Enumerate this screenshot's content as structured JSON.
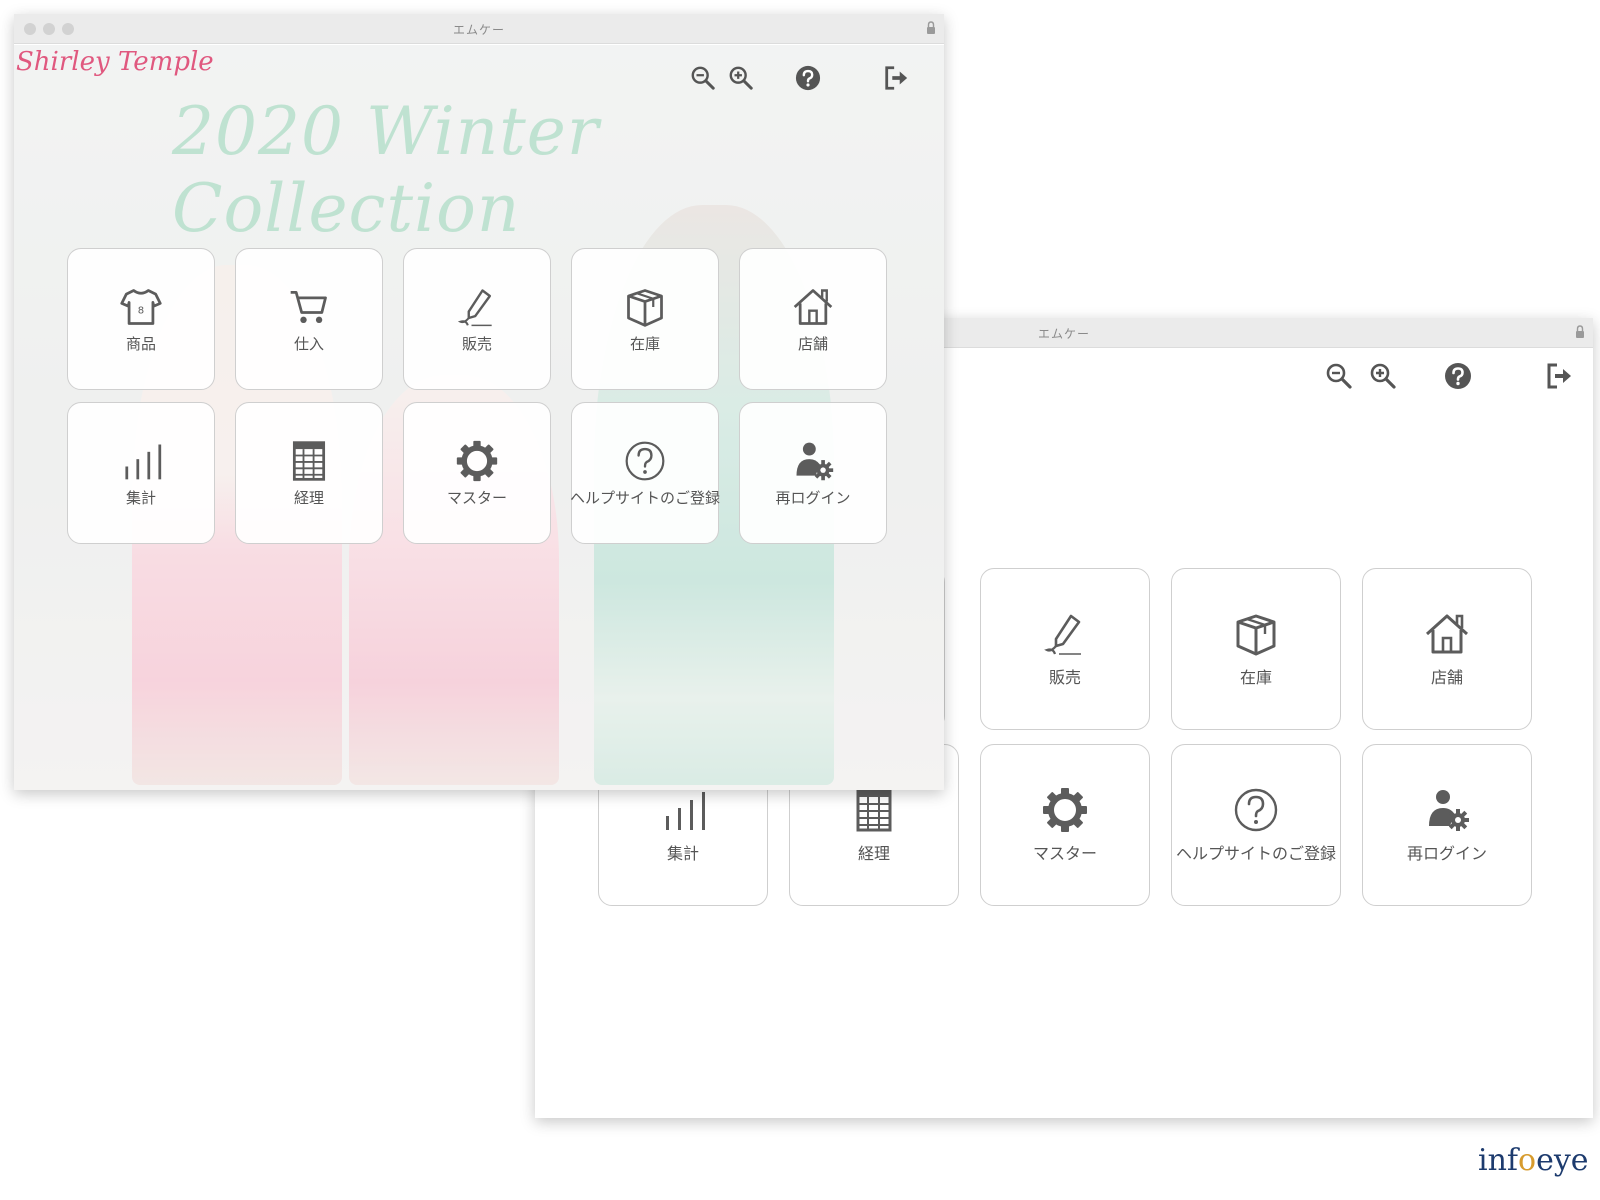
{
  "front_window": {
    "title": "エムケー",
    "brand": "Shirley Temple",
    "collection": "2020 Winter Collection",
    "tiles": [
      {
        "label": "商品",
        "icon": "shirt-icon"
      },
      {
        "label": "仕入",
        "icon": "cart-icon"
      },
      {
        "label": "販売",
        "icon": "pen-icon"
      },
      {
        "label": "在庫",
        "icon": "box-icon"
      },
      {
        "label": "店舗",
        "icon": "house-icon"
      },
      {
        "label": "集計",
        "icon": "bar-chart-icon"
      },
      {
        "label": "経理",
        "icon": "ledger-icon"
      },
      {
        "label": "マスター",
        "icon": "gear-icon"
      },
      {
        "label": "ヘルプサイトのご登録",
        "icon": "help-circle-icon"
      },
      {
        "label": "再ログイン",
        "icon": "user-gear-icon"
      }
    ]
  },
  "back_window": {
    "title": "エムケー",
    "tiles": [
      {
        "label": "販売",
        "icon": "pen-icon"
      },
      {
        "label": "在庫",
        "icon": "box-icon"
      },
      {
        "label": "店舗",
        "icon": "house-icon"
      },
      {
        "label": "集計",
        "icon": "bar-chart-icon"
      },
      {
        "label": "経理",
        "icon": "ledger-icon"
      },
      {
        "label": "マスター",
        "icon": "gear-icon"
      },
      {
        "label": "ヘルプサイトのご登録",
        "icon": "help-circle-icon"
      },
      {
        "label": "再ログイン",
        "icon": "user-gear-icon"
      }
    ]
  },
  "colors": {
    "icon": "#5c5c5c",
    "brand_pink": "#e0587f",
    "collection_mint": "#bfe2d1",
    "tile_border": "#cfcfcf"
  },
  "footer": {
    "logo_left": "inf",
    "logo_mid": "o",
    "logo_right": "eye"
  }
}
